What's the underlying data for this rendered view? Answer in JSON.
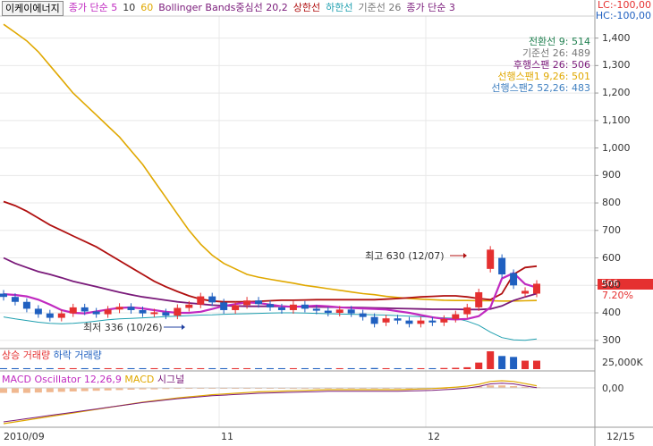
{
  "legend": {
    "stock_name": "이케이에너지",
    "ma_label": "종가 단순 5",
    "ma10": "10",
    "ma60": "60",
    "bollinger": "Bollinger Bands중심선 20,2",
    "upper": "상한선",
    "lower": "하한선",
    "kijun": "기준선 26",
    "ma3": "종가 단순 3"
  },
  "limits": {
    "lc": "LC:-100,00",
    "hc": "HC:-100,00"
  },
  "ichimoku": {
    "tenkan": "전환선 9: 514",
    "kijun": "기준선 26: 489",
    "chikou": "후행스팬 26: 506",
    "span1": "선행스팬1 9,26: 501",
    "span2": "선행스팬2 52,26: 483"
  },
  "annotations": {
    "high": "최고 630 (12/07)",
    "low": "최저 336 (10/26)"
  },
  "current": {
    "price": "506",
    "change": "7.20%"
  },
  "volume_legend": {
    "up": "상승 거래량",
    "down": "하락 거래량",
    "axis": "25,000K"
  },
  "macd_legend": {
    "osc": "MACD Oscillator 12,26,9",
    "macd": "MACD",
    "signal": "시그널",
    "axis": "0,00"
  },
  "dates": [
    "2010/09",
    "11",
    "12",
    "12/15"
  ],
  "colors": {
    "up": "#e53030",
    "down": "#2060c0",
    "ma5": "#c02ac0",
    "ma60": "#e0a800",
    "bb_mid": "#7a1a7a",
    "upper": "#b01010",
    "lower": "#20a0b0"
  },
  "chart_data": {
    "type": "line",
    "price_axis": {
      "ticks": [
        300,
        400,
        500,
        600,
        700,
        800,
        900,
        1000,
        1100,
        1200,
        1300,
        1400
      ],
      "ylim": [
        270,
        1480
      ]
    },
    "y_tick_labels": [
      "300",
      "400",
      "500",
      "600",
      "700",
      "800",
      "900",
      "1,000",
      "1,100",
      "1,200",
      "1,300",
      "1,400"
    ],
    "high": 630,
    "low": 336,
    "last": 506,
    "series": [
      {
        "name": "60",
        "values": [
          1450,
          1420,
          1390,
          1350,
          1300,
          1250,
          1200,
          1160,
          1120,
          1080,
          1040,
          990,
          940,
          880,
          820,
          760,
          700,
          650,
          610,
          580,
          560,
          540,
          530,
          522,
          515,
          508,
          500,
          494,
          488,
          482,
          476,
          470,
          466,
          460,
          456,
          452,
          450,
          448,
          446,
          445,
          445,
          444,
          444,
          443,
          443,
          444,
          445
        ]
      },
      {
        "name": "상한선",
        "values": [
          805,
          790,
          770,
          745,
          720,
          700,
          680,
          660,
          640,
          615,
          590,
          565,
          540,
          515,
          495,
          478,
          462,
          450,
          443,
          440,
          440,
          440,
          442,
          444,
          446,
          446,
          447,
          448,
          448,
          448,
          448,
          448,
          448,
          450,
          452,
          455,
          458,
          460,
          462,
          462,
          458,
          452,
          448,
          470,
          540,
          565,
          570
        ]
      },
      {
        "name": "Bollinger Bands중심선 20,2",
        "values": [
          600,
          580,
          565,
          550,
          540,
          528,
          515,
          505,
          495,
          485,
          475,
          466,
          458,
          452,
          446,
          440,
          436,
          432,
          428,
          426,
          425,
          424,
          424,
          424,
          424,
          423,
          422,
          422,
          421,
          420,
          420,
          419,
          418,
          417,
          416,
          415,
          414,
          413,
          413,
          413,
          412,
          412,
          414,
          425,
          445,
          458,
          470
        ]
      },
      {
        "name": "하한선",
        "values": [
          385,
          378,
          372,
          366,
          362,
          360,
          362,
          365,
          370,
          375,
          378,
          380,
          382,
          384,
          386,
          388,
          390,
          392,
          393,
          395,
          396,
          397,
          398,
          399,
          400,
          400,
          399,
          398,
          397,
          396,
          395,
          394,
          393,
          392,
          390,
          388,
          386,
          384,
          382,
          380,
          370,
          355,
          330,
          310,
          302,
          300,
          305
        ]
      },
      {
        "name": "종가 단순 5",
        "values": [
          468,
          465,
          460,
          448,
          430,
          410,
          400,
          398,
          405,
          412,
          418,
          420,
          416,
          410,
          404,
          400,
          400,
          404,
          414,
          425,
          432,
          438,
          436,
          430,
          424,
          422,
          424,
          426,
          424,
          420,
          418,
          416,
          414,
          412,
          406,
          400,
          392,
          384,
          378,
          376,
          378,
          388,
          420,
          525,
          545,
          505,
          492
        ]
      }
    ],
    "candles": [
      {
        "o": 470,
        "c": 458
      },
      {
        "o": 458,
        "c": 440
      },
      {
        "o": 440,
        "c": 415
      },
      {
        "o": 415,
        "c": 395
      },
      {
        "o": 398,
        "c": 382
      },
      {
        "o": 382,
        "c": 398
      },
      {
        "o": 398,
        "c": 420
      },
      {
        "o": 420,
        "c": 405
      },
      {
        "o": 405,
        "c": 395
      },
      {
        "o": 395,
        "c": 412
      },
      {
        "o": 412,
        "c": 422
      },
      {
        "o": 422,
        "c": 410
      },
      {
        "o": 410,
        "c": 398
      },
      {
        "o": 398,
        "c": 402
      },
      {
        "o": 402,
        "c": 390
      },
      {
        "o": 390,
        "c": 418
      },
      {
        "o": 418,
        "c": 430
      },
      {
        "o": 430,
        "c": 460
      },
      {
        "o": 460,
        "c": 438
      },
      {
        "o": 438,
        "c": 410
      },
      {
        "o": 410,
        "c": 428
      },
      {
        "o": 428,
        "c": 445
      },
      {
        "o": 445,
        "c": 432
      },
      {
        "o": 432,
        "c": 420
      },
      {
        "o": 420,
        "c": 410
      },
      {
        "o": 410,
        "c": 430
      },
      {
        "o": 430,
        "c": 415
      },
      {
        "o": 415,
        "c": 408
      },
      {
        "o": 408,
        "c": 400
      },
      {
        "o": 400,
        "c": 412
      },
      {
        "o": 412,
        "c": 398
      },
      {
        "o": 398,
        "c": 385
      },
      {
        "o": 385,
        "c": 360
      },
      {
        "o": 365,
        "c": 380
      },
      {
        "o": 380,
        "c": 372
      },
      {
        "o": 372,
        "c": 360
      },
      {
        "o": 360,
        "c": 372
      },
      {
        "o": 372,
        "c": 365
      },
      {
        "o": 365,
        "c": 378
      },
      {
        "o": 378,
        "c": 395
      },
      {
        "o": 395,
        "c": 420
      },
      {
        "o": 420,
        "c": 475
      },
      {
        "o": 560,
        "c": 630
      },
      {
        "o": 600,
        "c": 540
      },
      {
        "o": 545,
        "c": 500
      },
      {
        "o": 470,
        "c": 480
      },
      {
        "o": 470,
        "c": 506
      }
    ],
    "volume": [
      0.05,
      0.05,
      0.05,
      0.05,
      0.05,
      0.05,
      0.05,
      0.05,
      0.05,
      0.05,
      0.05,
      0.05,
      0.05,
      0.05,
      0.05,
      0.05,
      0.05,
      0.05,
      0.05,
      0.05,
      0.05,
      0.05,
      0.05,
      0.05,
      0.05,
      0.05,
      0.05,
      0.05,
      0.05,
      0.05,
      0.05,
      0.05,
      0.06,
      0.05,
      0.05,
      0.05,
      0.05,
      0.05,
      0.06,
      0.07,
      0.1,
      0.35,
      0.95,
      0.7,
      0.65,
      0.45,
      0.45
    ],
    "macd_osc": [
      -0.7,
      -0.7,
      -0.7,
      -0.65,
      -0.6,
      -0.55,
      -0.5,
      -0.45,
      -0.4,
      -0.35,
      -0.3,
      -0.25,
      -0.2,
      -0.2,
      -0.15,
      -0.1,
      -0.1,
      -0.05,
      0,
      0,
      0,
      0,
      0,
      0,
      0,
      0,
      0,
      0,
      0,
      0,
      0,
      0,
      0,
      0,
      0,
      0,
      0,
      0,
      0,
      0.05,
      0.1,
      0.2,
      0.35,
      0.35,
      0.25,
      0.15,
      0.1
    ],
    "macd_line": [
      -1,
      -0.95,
      -0.9,
      -0.85,
      -0.8,
      -0.75,
      -0.7,
      -0.65,
      -0.6,
      -0.55,
      -0.5,
      -0.45,
      -0.4,
      -0.36,
      -0.32,
      -0.28,
      -0.25,
      -0.22,
      -0.19,
      -0.17,
      -0.15,
      -0.13,
      -0.11,
      -0.1,
      -0.09,
      -0.08,
      -0.07,
      -0.06,
      -0.05,
      -0.05,
      -0.05,
      -0.05,
      -0.05,
      -0.05,
      -0.05,
      -0.04,
      -0.03,
      -0.02,
      0,
      0.02,
      0.05,
      0.1,
      0.18,
      0.2,
      0.18,
      0.12,
      0.06
    ]
  }
}
